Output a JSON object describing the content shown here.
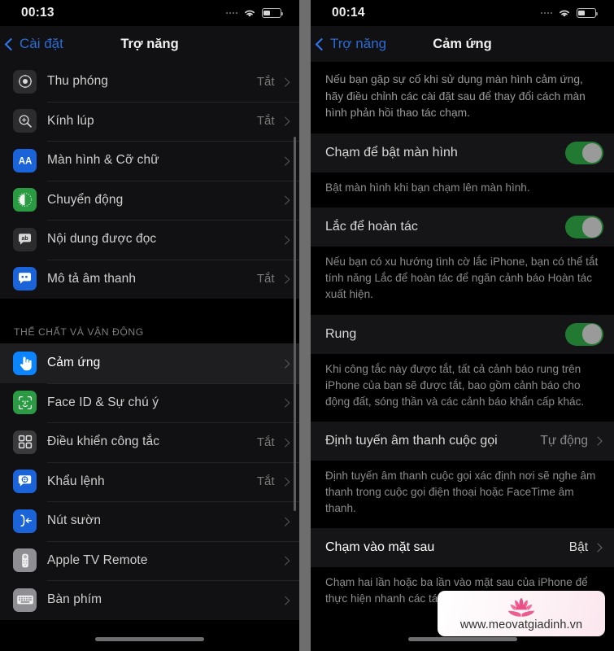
{
  "left_panel": {
    "status_bar": {
      "time": "00:13",
      "wifi_icon": "wifi-icon",
      "battery_icon": "battery-icon",
      "signal_icon": "signal-dots-icon"
    },
    "nav": {
      "back_label": "Cài đặt",
      "title": "Trợ năng"
    },
    "items": [
      {
        "label": "Thu phóng",
        "value": "Tắt",
        "icon": "zoom-icon",
        "icon_style": "ic-gray"
      },
      {
        "label": "Kính lúp",
        "value": "Tắt",
        "icon": "magnifier-icon",
        "icon_style": "ic-gray"
      },
      {
        "label": "Màn hình & Cỡ chữ",
        "value": "",
        "icon": "display-text-icon",
        "icon_style": "ic-blue"
      },
      {
        "label": "Chuyển động",
        "value": "",
        "icon": "motion-icon",
        "icon_style": "ic-green"
      },
      {
        "label": "Nội dung được đọc",
        "value": "",
        "icon": "spoken-content-icon",
        "icon_style": "ic-gray"
      },
      {
        "label": "Mô tả âm thanh",
        "value": "Tắt",
        "icon": "audio-description-icon",
        "icon_style": "ic-blue"
      }
    ],
    "section_header": "THỂ CHẤT VÀ VẬN ĐỘNG",
    "items2": [
      {
        "label": "Cảm ứng",
        "value": "",
        "icon": "touch-hand-icon",
        "icon_style": "ic-blue2",
        "selected": true
      },
      {
        "label": "Face ID & Sự chú ý",
        "value": "",
        "icon": "face-id-icon",
        "icon_style": "ic-green"
      },
      {
        "label": "Điều khiển công tắc",
        "value": "Tắt",
        "icon": "switch-control-icon",
        "icon_style": "ic-dgray"
      },
      {
        "label": "Khẩu lệnh",
        "value": "Tắt",
        "icon": "voice-control-icon",
        "icon_style": "ic-blue"
      },
      {
        "label": "Nút sườn",
        "value": "",
        "icon": "side-button-icon",
        "icon_style": "ic-blue"
      },
      {
        "label": "Apple TV Remote",
        "value": "",
        "icon": "tv-remote-icon",
        "icon_style": "ic-lgray"
      },
      {
        "label": "Bàn phím",
        "value": "",
        "icon": "keyboard-icon",
        "icon_style": "ic-lgray"
      }
    ]
  },
  "right_panel": {
    "status_bar": {
      "time": "00:14",
      "wifi_icon": "wifi-icon",
      "battery_icon": "battery-icon",
      "signal_icon": "signal-dots-icon"
    },
    "nav": {
      "back_label": "Trợ năng",
      "title": "Cảm ứng"
    },
    "intro": "Nếu bạn gặp sự cố khi sử dụng màn hình cảm ứng, hãy điều chỉnh các cài đặt sau để thay đổi cách màn hình phản hồi thao tác chạm.",
    "rows": [
      {
        "label": "Chạm để bật màn hình",
        "type": "switch",
        "switch_on": true,
        "footer": "Bật màn hình khi bạn chạm lên màn hình."
      },
      {
        "label": "Lắc để hoàn tác",
        "type": "switch",
        "switch_on": true,
        "footer": "Nếu bạn có xu hướng tình cờ lắc iPhone, bạn có thể tắt tính năng Lắc để hoàn tác để ngăn cảnh báo Hoàn tác xuất hiện."
      },
      {
        "label": "Rung",
        "type": "switch",
        "switch_on": true,
        "footer": "Khi công tắc này được tắt, tất cả cảnh báo rung trên iPhone của bạn sẽ được tắt, bao gồm cảnh báo cho động đất, sóng thần và các cảnh báo khẩn cấp khác."
      },
      {
        "label": "Định tuyến âm thanh cuộc gọi",
        "type": "value",
        "value": "Tự động",
        "footer": "Định tuyến âm thanh cuộc gọi xác định nơi sẽ nghe âm thanh trong cuộc gọi điện thoại hoặc FaceTime âm thanh."
      },
      {
        "label": "Chạm vào mặt sau",
        "type": "value",
        "value": "Bật",
        "bright": true,
        "footer": "Chạm hai lần hoặc ba lần vào mặt sau của iPhone để thực hiện nhanh các tác vụ."
      }
    ]
  },
  "watermark": {
    "text": "www.meovatgiadinh.vn",
    "logo": "lotus-icon",
    "accent": "#e8447f"
  }
}
